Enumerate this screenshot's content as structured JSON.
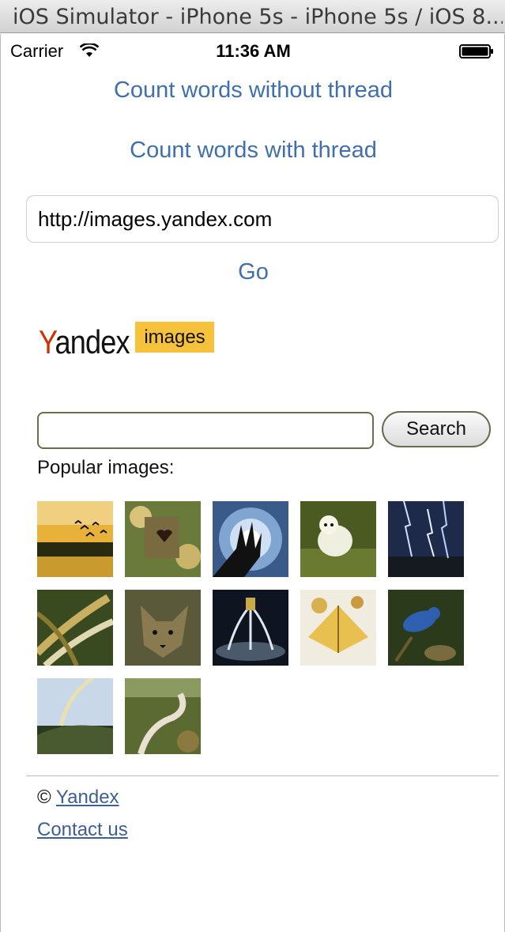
{
  "window": {
    "title": "iOS Simulator - iPhone 5s - iPhone 5s / iOS 8..."
  },
  "status_bar": {
    "carrier": "Carrier",
    "time": "11:36 AM"
  },
  "app": {
    "count_without_thread": "Count words without thread",
    "count_with_thread": "Count words with thread",
    "url_value": "http://images.yandex.com",
    "go_label": "Go"
  },
  "web": {
    "logo_word": "Yandex",
    "logo_badge": "images",
    "search_button": "Search",
    "popular_label": "Popular images:",
    "thumbnails": [
      "birds-sunset",
      "birdhouse-heart",
      "hand-spiral",
      "white-dog",
      "lightning",
      "leaves",
      "fox",
      "fountain-night",
      "cake",
      "blue-bird",
      "sky-rainbow",
      "river-valley"
    ],
    "footer": {
      "copyright_symbol": "©",
      "copyright_link": "Yandex",
      "contact": "Contact us"
    }
  },
  "colors": {
    "ios_blue": "#3f6fae",
    "badge_yellow": "#f6c13b",
    "link_blue": "#3e5f96"
  }
}
